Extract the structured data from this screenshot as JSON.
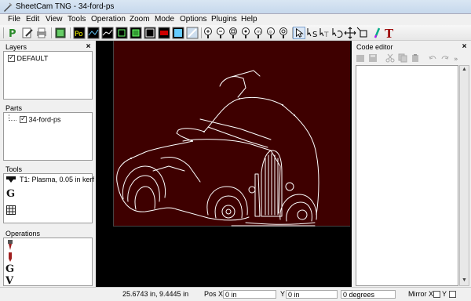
{
  "window": {
    "title": "SheetCam TNG - 34-ford-ps"
  },
  "menu": [
    "File",
    "Edit",
    "View",
    "Tools",
    "Operation",
    "Zoom",
    "Mode",
    "Options",
    "Plugins",
    "Help"
  ],
  "toolbar": {
    "icons": [
      "post-process-icon",
      "edit-icon",
      "print-icon",
      "setup-icon",
      "drill-icon",
      "line-tool-icon",
      "line-tool2-icon",
      "contour-icon",
      "pocket-icon",
      "shape-icon",
      "select-icon",
      "tool-color-icon",
      "zoom-icon",
      "zoom-in-icon",
      "zoom-out-icon",
      "zoom-fit-icon",
      "zoom-window-icon",
      "zoom-last-icon",
      "zoom-all-icon",
      "pointer-icon",
      "start-point-icon",
      "node-edit-icon",
      "rotate-icon",
      "move-icon",
      "scale-icon",
      "pen-icon",
      "text-icon"
    ]
  },
  "layers": {
    "title": "Layers",
    "items": [
      "DEFAULT"
    ]
  },
  "parts": {
    "title": "Parts",
    "items": [
      "34-ford-ps"
    ]
  },
  "tools": {
    "title": "Tools",
    "items": [
      "T1: Plasma, 0.05 in kerf"
    ]
  },
  "operations": {
    "title": "Operations"
  },
  "code_editor": {
    "title": "Code editor"
  },
  "status": {
    "coords": "25.6743 in, 9.4445 in",
    "pos_x_label": "Pos X",
    "pos_x_value": "0 in",
    "y_label": "Y",
    "y_value": "0 in",
    "angle_value": "0 degrees",
    "mirror_x_label": "Mirror X",
    "mirror_y_label": "Y"
  },
  "colors": {
    "sheet": "#3e0000",
    "canvas_bg": "#000000",
    "outline": "#ffffff"
  }
}
